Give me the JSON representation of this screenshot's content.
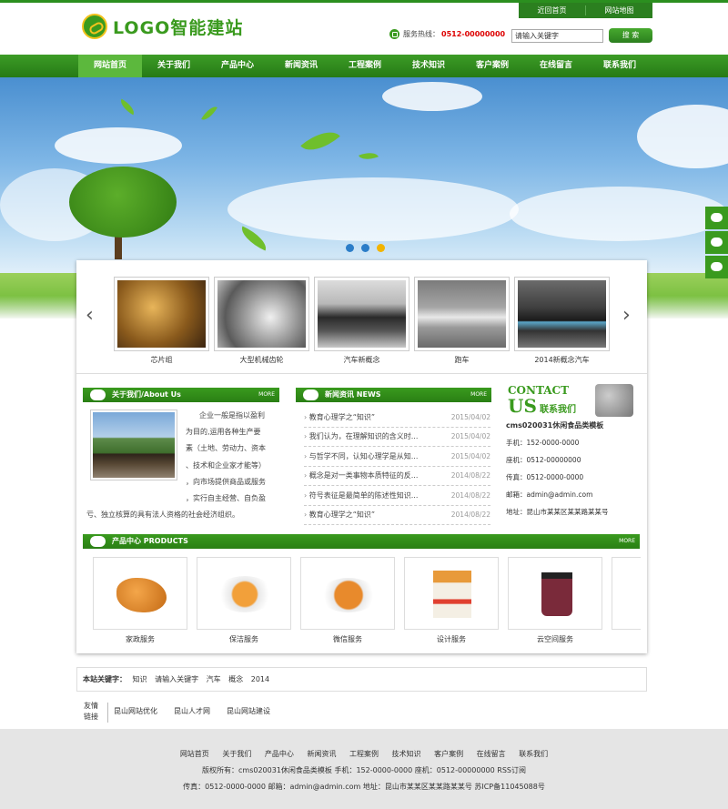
{
  "header": {
    "top_links": [
      "近回首页",
      "网站地图"
    ],
    "logo_text": "LOGO智能建站",
    "hotline_label": "服务热线：",
    "hotline_number": "0512-00000000",
    "search_value": "请输入关键字",
    "search_button": "搜 索"
  },
  "nav": {
    "items": [
      "网站首页",
      "关于我们",
      "产品中心",
      "新闻资讯",
      "工程案例",
      "技术知识",
      "客户案例",
      "在线留言",
      "联系我们"
    ]
  },
  "carousel": {
    "items": [
      "芯片组",
      "大型机械齿轮",
      "汽车新概念",
      "跑车",
      "2014新概念汽车"
    ]
  },
  "about": {
    "title": "关于我们/About Us",
    "more": "MORE",
    "text_lines": [
      "企业一般是指以盈利",
      "为目的,运用各种生产要",
      "素（土地、劳动力、资本",
      "、技术和企业家才能等）",
      "，向市场提供商品或服务",
      "，实行自主经营、自负盈"
    ],
    "text_last": "亏、独立核算的具有法人资格的社会经济组织。"
  },
  "news": {
    "title": "新闻资讯 NEWS",
    "more": "MORE",
    "items": [
      {
        "title": "教育心理学之“知识”",
        "date": "2015/04/02"
      },
      {
        "title": "我们认为，在理解知识的含义时...",
        "date": "2015/04/02"
      },
      {
        "title": "与哲学不同，认知心理学是从知...",
        "date": "2015/04/02"
      },
      {
        "title": "概念是对一类事物本质特征的反...",
        "date": "2014/08/22"
      },
      {
        "title": "符号表征是最简单的陈述性知识...",
        "date": "2014/08/22"
      },
      {
        "title": "教育心理学之“知识”",
        "date": "2014/08/22"
      }
    ]
  },
  "contact": {
    "heading1": "CONTACT",
    "heading2": "US",
    "heading_cn": "联系我们",
    "company": "cms020031休闲食品类模板",
    "mobile": "手机：152-0000-0000",
    "phone": "座机：0512-00000000",
    "fax": "传真：0512-0000-0000",
    "email": "邮箱：admin@admin.com",
    "address": "地址：昆山市某某区某某路某某号"
  },
  "products": {
    "title": "产品中心 PRODUCTS",
    "more": "MORE",
    "items": [
      "家政服务",
      "保洁服务",
      "微信服务",
      "设计服务",
      "云空间服务"
    ]
  },
  "keywords": {
    "label": "本站关键字：",
    "items": [
      "知识",
      "请输入关键字",
      "汽车",
      "概念",
      "2014"
    ]
  },
  "friend_links": {
    "label": "友情链接",
    "items": [
      "昆山网站优化",
      "昆山人才网",
      "昆山网站建设"
    ]
  },
  "footer": {
    "nav": [
      "网站首页",
      "关于我们",
      "产品中心",
      "新闻资讯",
      "工程案例",
      "技术知识",
      "客户案例",
      "在线留言",
      "联系我们"
    ],
    "line1": "版权所有：cms020031休闲食品类模板  手机：152-0000-0000  座机：0512-00000000  RSS订阅",
    "line2": "传真：0512-0000-0000  邮箱：admin@admin.com  地址：昆山市某某区某某路某某号  苏ICP备11045088号"
  },
  "colors": {
    "brand_green": "#3a9a1e",
    "dot_active": "#f2b400",
    "dot": "#2b7dc8",
    "hotline": "#dd0000"
  }
}
